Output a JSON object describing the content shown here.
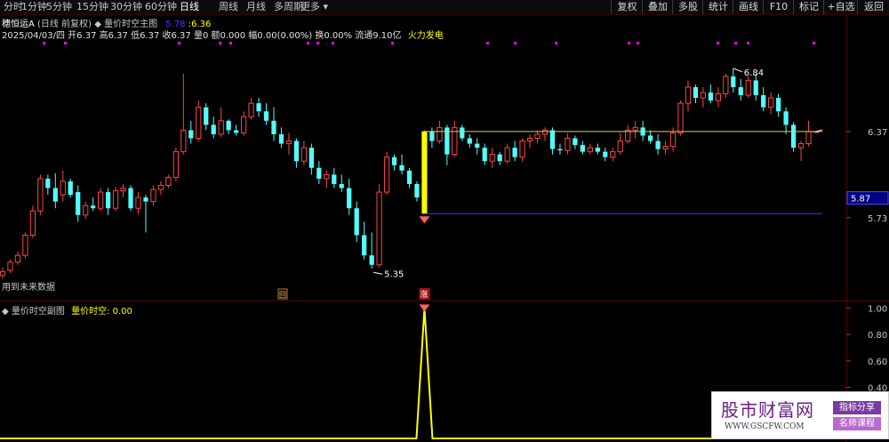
{
  "toolbar": {
    "periods": [
      "分时",
      "1分钟",
      "5分钟",
      "15分钟",
      "30分钟",
      "60分钟",
      "日线",
      "周线",
      "月线",
      "多周期",
      "更多"
    ],
    "active_period": "日线",
    "right_buttons": [
      "复权",
      "叠加",
      "多股",
      "统计",
      "画线",
      "F10",
      "标记",
      "+自选",
      "返回"
    ]
  },
  "main_panel": {
    "stock_title": "穗恒运A",
    "adjust_note": "(日线 前复权)",
    "indicator_name": "量价时空主图",
    "indicator_values": [
      "5.78",
      ":6.36"
    ],
    "quote_line": "2025/04/03/四 开6.37 高6.37 低6.37 收6.37 量0 额0.000 幅0.00(0.00%) 换0.00% 流通9.10亿",
    "tag": "火力发电",
    "future_data_note": "用到未来数据",
    "max_price_label": "6.84",
    "min_price_label": "5.35",
    "current_price_axis_label": "5.87",
    "yellow_level": 6.37,
    "blue_level": 5.76,
    "bar_signal_text": "涨",
    "bar_left_marker": "回",
    "axis_ticks": [
      "6.37",
      "5.73"
    ]
  },
  "sub_panel": {
    "title": "量价时空副图",
    "indicator_label": "量价时空:",
    "indicator_value": "0.00",
    "axis_ticks": [
      "1.00",
      "0.80",
      "0.60",
      "0.40"
    ]
  },
  "chart_data": [
    {
      "type": "candlestick",
      "title": "量价时空主图",
      "ylim": [
        5.2,
        7.05
      ],
      "candles": [
        [
          5.3,
          5.36,
          5.28,
          5.33
        ],
        [
          5.34,
          5.42,
          5.32,
          5.4
        ],
        [
          5.4,
          5.48,
          5.38,
          5.45
        ],
        [
          5.45,
          5.62,
          5.43,
          5.6
        ],
        [
          5.6,
          5.82,
          5.58,
          5.78
        ],
        [
          5.78,
          6.05,
          5.75,
          6.02
        ],
        [
          6.02,
          6.05,
          5.9,
          5.95
        ],
        [
          5.95,
          6.06,
          5.8,
          5.85
        ],
        [
          5.9,
          6.08,
          5.85,
          6.0
        ],
        [
          6.0,
          6.02,
          5.88,
          5.9
        ],
        [
          5.92,
          5.97,
          5.7,
          5.75
        ],
        [
          5.75,
          5.85,
          5.72,
          5.82
        ],
        [
          5.82,
          5.88,
          5.78,
          5.8
        ],
        [
          5.8,
          5.95,
          5.78,
          5.92
        ],
        [
          5.92,
          5.95,
          5.75,
          5.8
        ],
        [
          5.8,
          5.96,
          5.78,
          5.93
        ],
        [
          5.93,
          5.98,
          5.88,
          5.95
        ],
        [
          5.95,
          5.97,
          5.78,
          5.8
        ],
        [
          5.8,
          5.92,
          5.76,
          5.88
        ],
        [
          5.88,
          5.9,
          5.62,
          5.85
        ],
        [
          5.85,
          5.97,
          5.82,
          5.94
        ],
        [
          5.94,
          6.0,
          5.9,
          5.97
        ],
        [
          5.97,
          6.05,
          5.95,
          6.03
        ],
        [
          6.03,
          6.25,
          6.0,
          6.22
        ],
        [
          6.22,
          6.8,
          6.2,
          6.38
        ],
        [
          6.38,
          6.45,
          6.28,
          6.32
        ],
        [
          6.32,
          6.6,
          6.3,
          6.55
        ],
        [
          6.55,
          6.58,
          6.38,
          6.42
        ],
        [
          6.42,
          6.48,
          6.32,
          6.35
        ],
        [
          6.35,
          6.55,
          6.33,
          6.45
        ],
        [
          6.45,
          6.46,
          6.35,
          6.38
        ],
        [
          6.38,
          6.42,
          6.34,
          6.36
        ],
        [
          6.36,
          6.52,
          6.34,
          6.48
        ],
        [
          6.48,
          6.62,
          6.46,
          6.58
        ],
        [
          6.58,
          6.62,
          6.48,
          6.52
        ],
        [
          6.52,
          6.58,
          6.42,
          6.45
        ],
        [
          6.45,
          6.55,
          6.3,
          6.35
        ],
        [
          6.35,
          6.4,
          6.25,
          6.28
        ],
        [
          6.28,
          6.36,
          6.2,
          6.3
        ],
        [
          6.3,
          6.32,
          6.1,
          6.15
        ],
        [
          6.15,
          6.3,
          6.12,
          6.25
        ],
        [
          6.25,
          6.28,
          6.05,
          6.1
        ],
        [
          6.1,
          6.15,
          5.98,
          6.02
        ],
        [
          6.02,
          6.08,
          5.95,
          6.05
        ],
        [
          6.05,
          6.1,
          5.95,
          5.98
        ],
        [
          5.98,
          6.05,
          5.92,
          5.95
        ],
        [
          5.95,
          6.02,
          5.75,
          5.8
        ],
        [
          5.8,
          5.85,
          5.55,
          5.6
        ],
        [
          5.6,
          5.7,
          5.42,
          5.45
        ],
        [
          5.45,
          5.62,
          5.35,
          5.38
        ],
        [
          5.38,
          5.98,
          5.36,
          5.92
        ],
        [
          5.92,
          6.22,
          5.9,
          6.18
        ],
        [
          6.18,
          6.2,
          6.08,
          6.12
        ],
        [
          6.12,
          6.2,
          6.05,
          6.08
        ],
        [
          6.08,
          6.1,
          5.95,
          5.98
        ],
        [
          5.98,
          6.0,
          5.85,
          5.88
        ],
        [
          5.88,
          6.38,
          5.86,
          6.37
        ],
        [
          6.37,
          6.4,
          6.25,
          6.3
        ],
        [
          6.3,
          6.45,
          6.28,
          6.4
        ],
        [
          6.4,
          6.42,
          6.12,
          6.2
        ],
        [
          6.2,
          6.45,
          6.18,
          6.4
        ],
        [
          6.4,
          6.42,
          6.3,
          6.32
        ],
        [
          6.32,
          6.35,
          6.25,
          6.28
        ],
        [
          6.28,
          6.32,
          6.2,
          6.25
        ],
        [
          6.25,
          6.28,
          6.12,
          6.15
        ],
        [
          6.15,
          6.25,
          6.1,
          6.2
        ],
        [
          6.2,
          6.22,
          6.12,
          6.15
        ],
        [
          6.15,
          6.28,
          6.13,
          6.25
        ],
        [
          6.25,
          6.3,
          6.15,
          6.18
        ],
        [
          6.18,
          6.32,
          6.15,
          6.3
        ],
        [
          6.3,
          6.35,
          6.25,
          6.32
        ],
        [
          6.32,
          6.38,
          6.28,
          6.35
        ],
        [
          6.35,
          6.4,
          6.3,
          6.38
        ],
        [
          6.38,
          6.4,
          6.2,
          6.24
        ],
        [
          6.24,
          6.28,
          6.2,
          6.23
        ],
        [
          6.23,
          6.36,
          6.2,
          6.32
        ],
        [
          6.32,
          6.34,
          6.24,
          6.27
        ],
        [
          6.27,
          6.3,
          6.2,
          6.22
        ],
        [
          6.22,
          6.28,
          6.2,
          6.25
        ],
        [
          6.25,
          6.28,
          6.2,
          6.22
        ],
        [
          6.22,
          6.25,
          6.15,
          6.18
        ],
        [
          6.18,
          6.25,
          6.15,
          6.22
        ],
        [
          6.22,
          6.36,
          6.2,
          6.3
        ],
        [
          6.3,
          6.42,
          6.28,
          6.38
        ],
        [
          6.38,
          6.45,
          6.32,
          6.4
        ],
        [
          6.4,
          6.45,
          6.3,
          6.34
        ],
        [
          6.34,
          6.38,
          6.28,
          6.3
        ],
        [
          6.3,
          6.35,
          6.2,
          6.24
        ],
        [
          6.24,
          6.3,
          6.2,
          6.26
        ],
        [
          6.26,
          6.4,
          6.22,
          6.36
        ],
        [
          6.36,
          6.6,
          6.34,
          6.58
        ],
        [
          6.58,
          6.75,
          6.52,
          6.7
        ],
        [
          6.7,
          6.72,
          6.58,
          6.62
        ],
        [
          6.62,
          6.7,
          6.55,
          6.66
        ],
        [
          6.66,
          6.72,
          6.58,
          6.6
        ],
        [
          6.6,
          6.7,
          6.55,
          6.65
        ],
        [
          6.65,
          6.8,
          6.62,
          6.78
        ],
        [
          6.78,
          6.84,
          6.66,
          6.7
        ],
        [
          6.7,
          6.76,
          6.6,
          6.64
        ],
        [
          6.64,
          6.78,
          6.62,
          6.75
        ],
        [
          6.75,
          6.8,
          6.6,
          6.64
        ],
        [
          6.64,
          6.7,
          6.52,
          6.55
        ],
        [
          6.55,
          6.66,
          6.5,
          6.62
        ],
        [
          6.62,
          6.65,
          6.48,
          6.52
        ],
        [
          6.52,
          6.55,
          6.35,
          6.42
        ],
        [
          6.42,
          6.44,
          6.22,
          6.25
        ],
        [
          6.25,
          6.3,
          6.15,
          6.28
        ],
        [
          6.28,
          6.45,
          6.26,
          6.37
        ],
        [
          6.37,
          6.37,
          6.37,
          6.37
        ]
      ],
      "yellow_level": 6.37,
      "blue_level": 5.76,
      "max_label": "6.84",
      "min_label": "5.35"
    },
    {
      "type": "line",
      "title": "量价时空副图",
      "ylim": [
        0,
        1.05
      ],
      "series": [
        {
          "name": "量价时空",
          "peak_index": 56,
          "values_note": "",
          "peak_value": 1.0
        }
      ]
    }
  ],
  "watermark": {
    "title": "股市财富网",
    "url": "WWW.GSCFW.COM",
    "tag1": "指标分享",
    "tag2": "名师课程"
  },
  "colors": {
    "up": "#ff4444",
    "down": "#54fcfc",
    "yellow": "#ffff00",
    "blue": "#3b3bff",
    "grid": "#5a0000",
    "magenta": "#ff00ff"
  }
}
